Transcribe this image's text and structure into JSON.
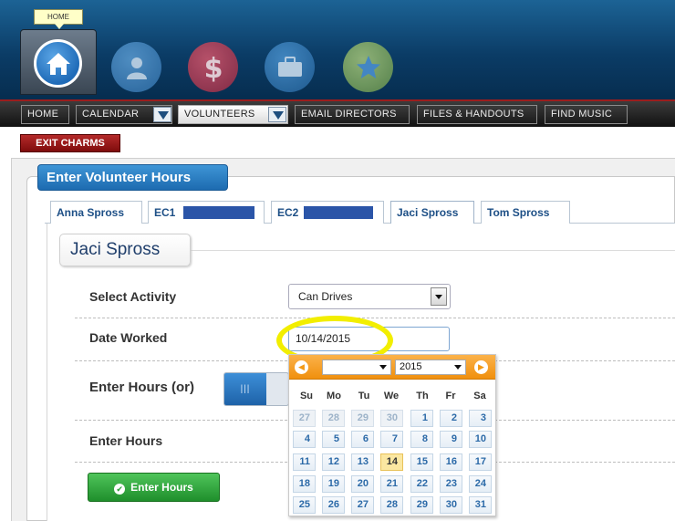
{
  "header": {
    "home_tooltip": "HOME",
    "icons": [
      "home-icon",
      "volunteer-icon",
      "dollar-icon",
      "briefcase-icon",
      "star-icon"
    ]
  },
  "nav": {
    "home": "HOME",
    "calendar": "CALENDAR",
    "volunteers": "VOLUNTEERS",
    "email_directors": "EMAIL DIRECTORS",
    "files_handouts": "FILES & HANDOUTS",
    "find_music": "FIND MUSIC"
  },
  "exit_charms": "EXIT CHARMS",
  "panel_title": "Enter Volunteer Hours",
  "tabs": [
    "Anna Spross",
    "EC1",
    "EC2",
    "Jaci Spross",
    "Tom Spross"
  ],
  "active_person": "Jaci Spross",
  "form": {
    "select_activity_label": "Select Activity",
    "select_activity_value": "Can Drives",
    "date_worked_label": "Date Worked",
    "date_worked_value": "10/14/2015",
    "enter_hours_or_label": "Enter Hours (or)",
    "enter_hours_label": "Enter Hours",
    "toggle_knob": "|||",
    "submit_label": "Enter Hours"
  },
  "datepicker": {
    "year": "2015",
    "weekdays": [
      "Su",
      "Mo",
      "Tu",
      "We",
      "Th",
      "Fr",
      "Sa"
    ],
    "weeks": [
      [
        "27",
        "28",
        "29",
        "30",
        "1",
        "2",
        "3"
      ],
      [
        "4",
        "5",
        "6",
        "7",
        "8",
        "9",
        "10"
      ],
      [
        "11",
        "12",
        "13",
        "14",
        "15",
        "16",
        "17"
      ],
      [
        "18",
        "19",
        "20",
        "21",
        "22",
        "23",
        "24"
      ],
      [
        "25",
        "26",
        "27",
        "28",
        "29",
        "30",
        "31"
      ]
    ],
    "selected_day": "14"
  },
  "colors": {
    "accent_blue": "#1d6bb0",
    "exit_red": "#9b1b1b",
    "datepicker_orange": "#f39a17",
    "enter_green": "#2a9d36",
    "highlight_yellow": "#f2ee00"
  }
}
